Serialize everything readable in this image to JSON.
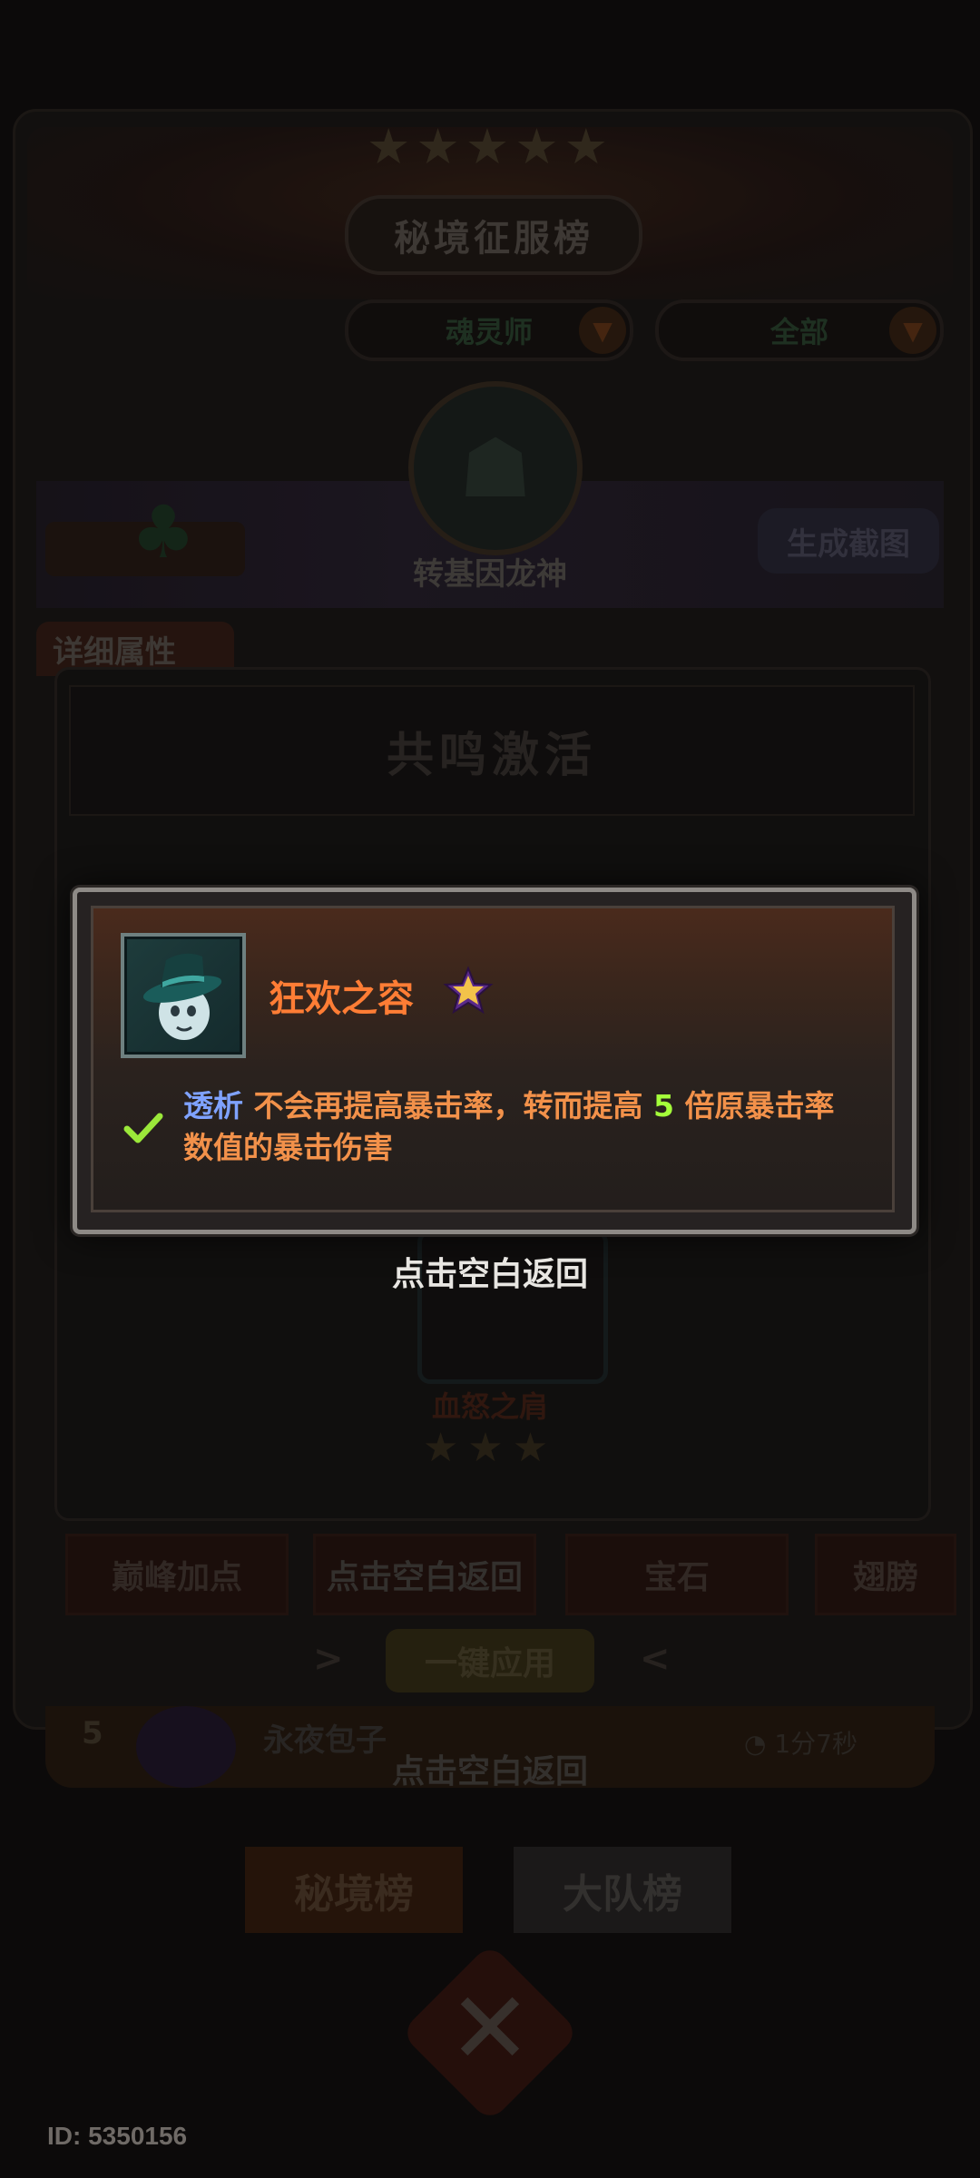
{
  "screen": {
    "title": "秘境征服榜",
    "class_filter": "魂灵师",
    "scope_filter": "全部",
    "hero_name": "转基因龙神",
    "screenshot_button": "生成截图",
    "detail_tab": "详细属性",
    "resonance_label": "共鸣激活",
    "slot_item_name": "血怒之肩",
    "bottom_tabs": [
      "巅峰加点",
      "点击空白返回",
      "宝石",
      "翅膀"
    ],
    "apply_button": "一键应用",
    "rank_row": {
      "rank": "5",
      "name": "永夜包子",
      "time": "1分7秒",
      "hint": "点击空白返回"
    },
    "leaderboard_tabs": [
      "秘境榜",
      "大队榜"
    ],
    "user_id": "ID: 5350156"
  },
  "popup": {
    "item_name": "狂欢之容",
    "description": {
      "keyword": "透析",
      "text_a": " 不会再提高暴击率，转而提高 ",
      "number": "5",
      "text_b": " 倍原暴击率数值的暴击伤害"
    },
    "tap_hint": "点击空白返回"
  },
  "colors": {
    "item_name": "#ff7d35",
    "keyword": "#7fa2ff",
    "number": "#a4ff3a",
    "description": "#f2914a",
    "check": "#9be83a"
  },
  "icons": [
    "hat-item-icon",
    "star-rank-icon",
    "check-icon",
    "dropdown-arrow-icon",
    "close-emblem-icon"
  ]
}
